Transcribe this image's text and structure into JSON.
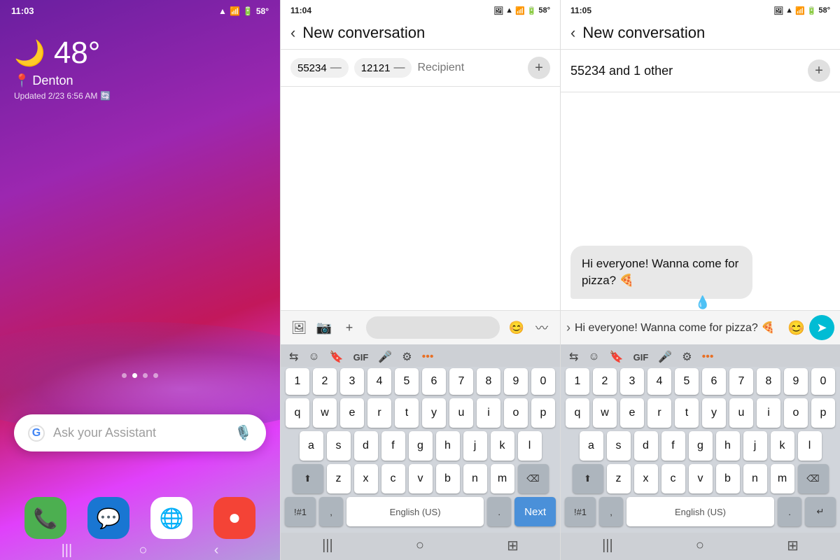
{
  "screen1": {
    "status_time": "11:03",
    "status_battery": "58°",
    "weather_emoji": "🌙",
    "temperature": "48°",
    "location": "Denton",
    "updated": "Updated 2/23 6:56 AM",
    "assistant_placeholder": "Ask your Assistant",
    "dock": [
      {
        "icon": "📞",
        "label": "Phone",
        "bg": "#4caf50"
      },
      {
        "icon": "💬",
        "label": "Messages",
        "bg": "#1976d2"
      },
      {
        "icon": "⚙",
        "label": "Chrome",
        "bg": "#fff"
      },
      {
        "icon": "⏺",
        "label": "Screen Recorder",
        "bg": "#f44336"
      }
    ]
  },
  "screen2": {
    "status_time": "11:04",
    "status_battery": "58°",
    "title": "New conversation",
    "chips": [
      "55234",
      "12121"
    ],
    "recipient_placeholder": "Recipient",
    "keyboard": {
      "language": "English (US)",
      "next_label": "Next",
      "numbers": [
        "1",
        "2",
        "3",
        "4",
        "5",
        "6",
        "7",
        "8",
        "9",
        "0"
      ],
      "row1": [
        "q",
        "w",
        "e",
        "r",
        "t",
        "y",
        "u",
        "i",
        "o",
        "p"
      ],
      "row2": [
        "a",
        "s",
        "d",
        "f",
        "g",
        "h",
        "j",
        "k",
        "l"
      ],
      "row3": [
        "z",
        "x",
        "c",
        "v",
        "b",
        "n",
        "m"
      ]
    }
  },
  "screen3": {
    "status_time": "11:05",
    "status_battery": "58°",
    "title": "New conversation",
    "recipients_text": "55234 and 1 other",
    "message_text": "Hi everyone! Wanna come for pizza? 🍕",
    "keyboard": {
      "language": "English (US)",
      "numbers": [
        "1",
        "2",
        "3",
        "4",
        "5",
        "6",
        "7",
        "8",
        "9",
        "0"
      ],
      "row1": [
        "q",
        "w",
        "e",
        "r",
        "t",
        "y",
        "u",
        "i",
        "o",
        "p"
      ],
      "row2": [
        "a",
        "s",
        "d",
        "f",
        "g",
        "h",
        "j",
        "k",
        "l"
      ],
      "row3": [
        "z",
        "x",
        "c",
        "v",
        "b",
        "n",
        "m"
      ]
    }
  }
}
